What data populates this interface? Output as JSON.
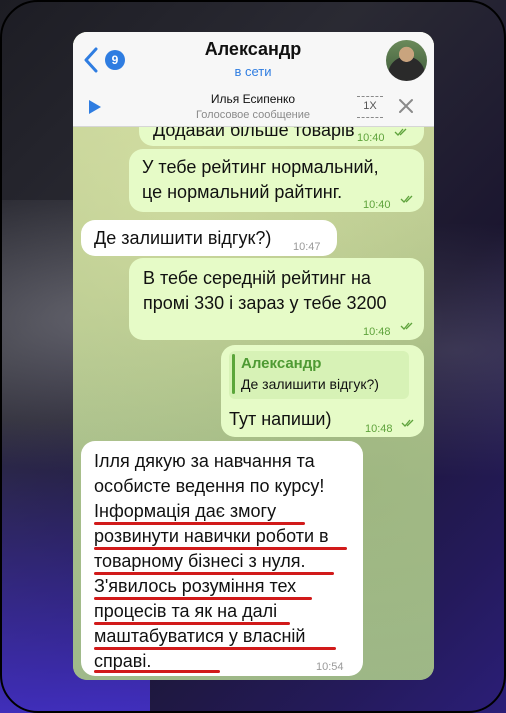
{
  "chat": {
    "back_badge": "9",
    "contact_name": "Александр",
    "status": "в сети"
  },
  "voice_player": {
    "name": "Илья Есипенко",
    "subtitle": "Голосовое сообщение",
    "speed": "1X"
  },
  "messages": [
    {
      "dir": "out",
      "text": "Додавай більше товарів",
      "time": "10:40"
    },
    {
      "dir": "out",
      "lines": [
        "У тебе рейтинг нормальний,",
        "це нормальний райтинг."
      ],
      "time": "10:40"
    },
    {
      "dir": "in",
      "text": "Де залишити відгук?)",
      "time": "10:47"
    },
    {
      "dir": "out",
      "lines": [
        "В тебе середній рейтинг на",
        "промі 330 і зараз у тебе 3200"
      ],
      "time": "10:48"
    },
    {
      "dir": "out",
      "reply": {
        "author": "Александр",
        "text": "Де залишити відгук?)"
      },
      "text": "Тут напиши)",
      "time": "10:48"
    },
    {
      "dir": "in",
      "lines": [
        "Ілля дякую за навчання та",
        "особисте ведення по курсу!",
        "Інформація дає змогу",
        "розвинути навички роботи в",
        "товарному бізнесі з нуля.",
        "З'явилось розуміння тех",
        "процесів та як на далі",
        "маштабуватися у власній",
        "справі."
      ],
      "time": "10:54"
    }
  ],
  "colors": {
    "accent": "#2f7de1",
    "outgoing_bubble": "#e6fbc7",
    "incoming_bubble": "#ffffff",
    "highlight_underline": "#d11a1a"
  }
}
